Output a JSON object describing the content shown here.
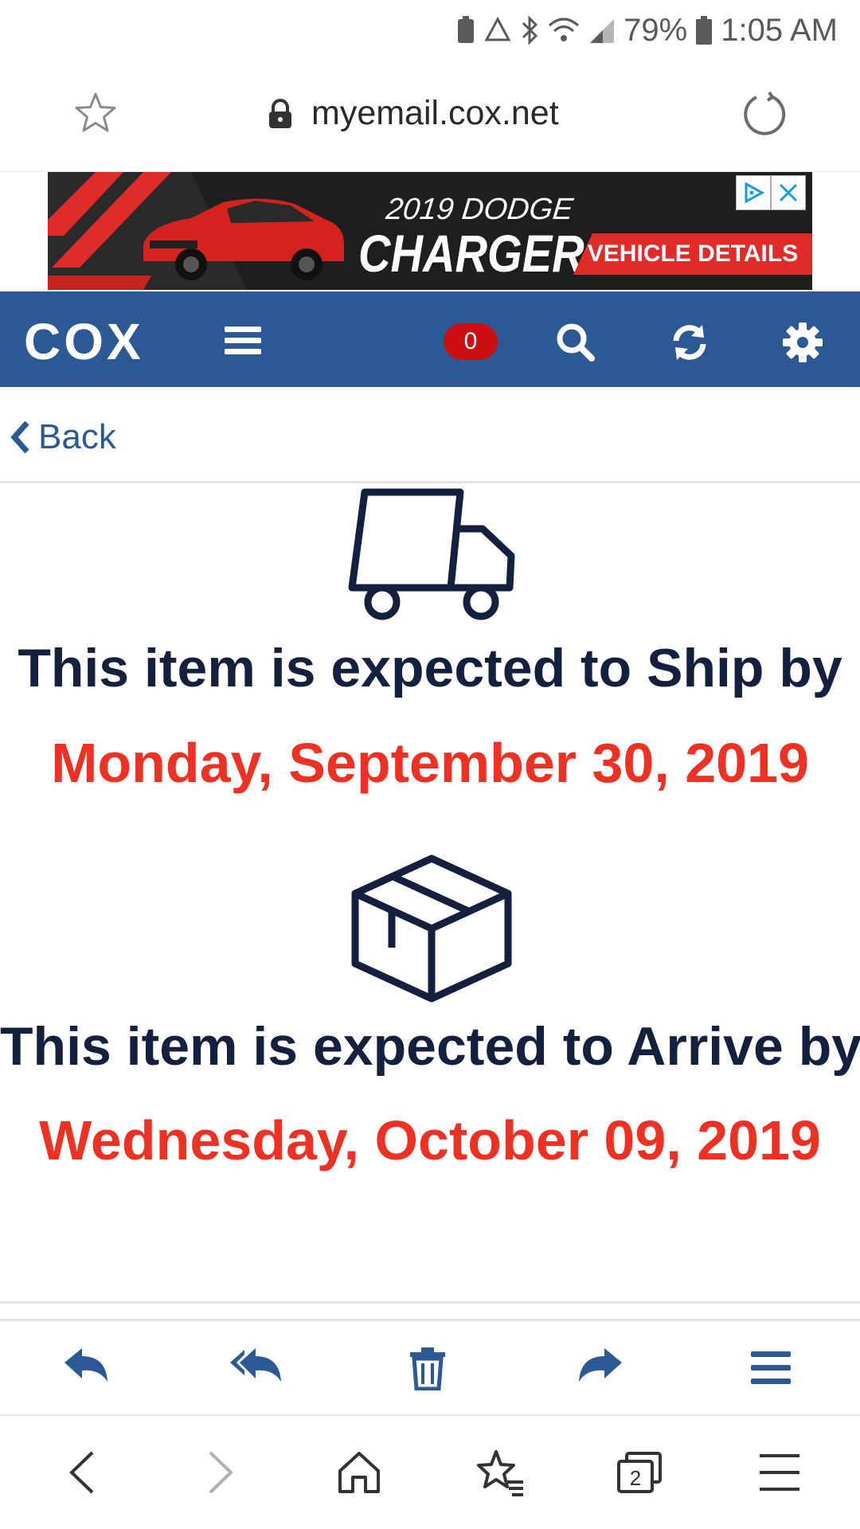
{
  "status_bar": {
    "battery_percent": "79%",
    "time": "1:05 AM"
  },
  "address_bar": {
    "url": "myemail.cox.net"
  },
  "ad": {
    "line1": "2019 DODGE",
    "line2": "CHARGER",
    "cta": "VEHICLE DETAILS"
  },
  "app_header": {
    "logo": "COX",
    "unread_count": "0"
  },
  "nav": {
    "back_label": "Back"
  },
  "shipping": {
    "ship_text": "This item is expected to Ship by",
    "ship_date": "Monday, September 30, 2019",
    "arrive_text": "This item is expected to Arrive by",
    "arrive_date": "Wednesday, October 09, 2019"
  },
  "browser_nav": {
    "tab_count": "2"
  },
  "colors": {
    "header_blue": "#2b5994",
    "headline_navy": "#13213f",
    "date_red": "#ef3124",
    "badge_red": "#cc0f12"
  }
}
